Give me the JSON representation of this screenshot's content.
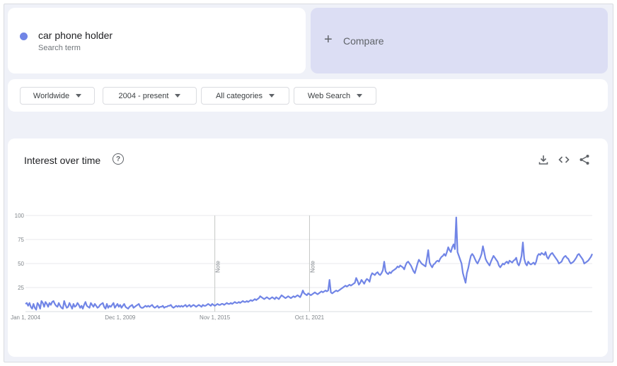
{
  "search_term": {
    "name": "car phone holder",
    "sublabel": "Search term",
    "color": "#7185e6"
  },
  "compare": {
    "plus": "+",
    "label": "Compare",
    "bg": "#dcdef4"
  },
  "filters": [
    {
      "label": "Worldwide"
    },
    {
      "label": "2004 - present"
    },
    {
      "label": "All categories"
    },
    {
      "label": "Web Search"
    }
  ],
  "chart_section": {
    "title": "Interest over time",
    "help": "?",
    "icons": [
      "download-icon",
      "embed-code-icon",
      "share-icon"
    ]
  },
  "chart_data": {
    "type": "line",
    "title": "Interest over time",
    "xlabel": "",
    "ylabel": "",
    "ylim": [
      0,
      100
    ],
    "yticks": [
      "25",
      "50",
      "75",
      "100"
    ],
    "xticks": [
      "Jan 1, 2004",
      "Dec 1, 2009",
      "Nov 1, 2015",
      "Oct 1, 2021"
    ],
    "grid": true,
    "notes": [
      {
        "label": "Note",
        "x": "Nov 1, 2015"
      },
      {
        "label": "Note",
        "x": "Oct 1, 2021"
      }
    ],
    "series": [
      {
        "color": "#7185e6",
        "x_start": "2004-01",
        "interval": "month",
        "values": [
          8,
          9,
          6,
          9,
          5,
          3,
          8,
          4,
          2,
          9,
          7,
          3,
          11,
          9,
          5,
          10,
          8,
          5,
          9,
          7,
          10,
          11,
          8,
          6,
          5,
          9,
          6,
          4,
          3,
          11,
          7,
          4,
          5,
          9,
          6,
          3,
          8,
          5,
          6,
          9,
          7,
          4,
          6,
          3,
          7,
          10,
          6,
          5,
          4,
          9,
          7,
          5,
          8,
          6,
          4,
          5,
          7,
          8,
          9,
          5,
          3,
          8,
          4,
          6,
          5,
          7,
          9,
          4,
          6,
          8,
          5,
          7,
          4,
          6,
          8,
          5,
          4,
          3,
          5,
          6,
          7,
          4,
          5,
          6,
          7,
          8,
          5,
          4,
          4,
          5,
          6,
          5,
          6,
          5,
          6,
          7,
          5,
          4,
          5,
          6,
          4,
          5,
          5,
          6,
          4,
          5,
          5,
          6,
          6,
          7,
          5,
          4,
          5,
          6,
          5,
          6,
          5,
          6,
          5,
          6,
          7,
          5,
          6,
          7,
          5,
          6,
          7,
          6,
          5,
          6,
          7,
          6,
          5,
          7,
          6,
          6,
          7,
          8,
          7,
          6,
          8,
          7,
          6,
          7,
          8,
          7,
          7,
          8,
          8,
          7,
          8,
          9,
          8,
          8,
          9,
          8,
          9,
          10,
          9,
          9,
          10,
          9,
          10,
          11,
          10,
          10,
          11,
          10,
          11,
          12,
          11,
          12,
          13,
          12,
          13,
          14,
          16,
          15,
          14,
          13,
          14,
          15,
          14,
          13,
          14,
          15,
          14,
          13,
          15,
          14,
          13,
          15,
          17,
          16,
          15,
          14,
          15,
          16,
          15,
          14,
          15,
          16,
          15,
          16,
          17,
          16,
          15,
          18,
          22,
          19,
          18,
          17,
          19,
          18,
          17,
          18,
          19,
          20,
          19,
          18,
          19,
          20,
          21,
          20,
          21,
          22,
          21,
          22,
          33,
          20,
          19,
          20,
          21,
          22,
          21,
          22,
          23,
          24,
          25,
          26,
          27,
          26,
          27,
          28,
          27,
          28,
          29,
          30,
          35,
          32,
          28,
          30,
          33,
          31,
          29,
          32,
          34,
          33,
          31,
          37,
          40,
          39,
          38,
          40,
          41,
          39,
          38,
          40,
          43,
          52,
          42,
          40,
          39,
          41,
          40,
          42,
          43,
          44,
          45,
          47,
          46,
          48,
          47,
          46,
          44,
          48,
          51,
          52,
          50,
          48,
          45,
          42,
          40,
          45,
          50,
          54,
          52,
          50,
          49,
          48,
          47,
          55,
          64,
          51,
          48,
          46,
          49,
          50,
          52,
          53,
          52,
          55,
          57,
          58,
          60,
          58,
          62,
          67,
          64,
          62,
          67,
          70,
          65,
          98,
          62,
          58,
          54,
          50,
          40,
          35,
          30,
          40,
          45,
          52,
          58,
          60,
          58,
          55,
          52,
          50,
          53,
          56,
          60,
          68,
          62,
          55,
          52,
          50,
          48,
          52,
          55,
          58,
          56,
          54,
          52,
          48,
          46,
          48,
          50,
          49,
          51,
          52,
          50,
          53,
          52,
          51,
          53,
          54,
          56,
          50,
          48,
          52,
          58,
          72,
          55,
          50,
          48,
          52,
          50,
          49,
          50,
          51,
          49,
          52,
          58,
          60,
          59,
          61,
          60,
          59,
          62,
          57,
          55,
          58,
          60,
          61,
          59,
          57,
          55,
          53,
          50,
          51,
          52,
          55,
          57,
          58,
          56,
          55,
          52,
          50,
          51,
          52,
          54,
          56,
          59,
          60,
          58,
          56,
          54,
          50,
          51,
          52,
          53,
          55,
          57,
          60
        ]
      }
    ]
  }
}
